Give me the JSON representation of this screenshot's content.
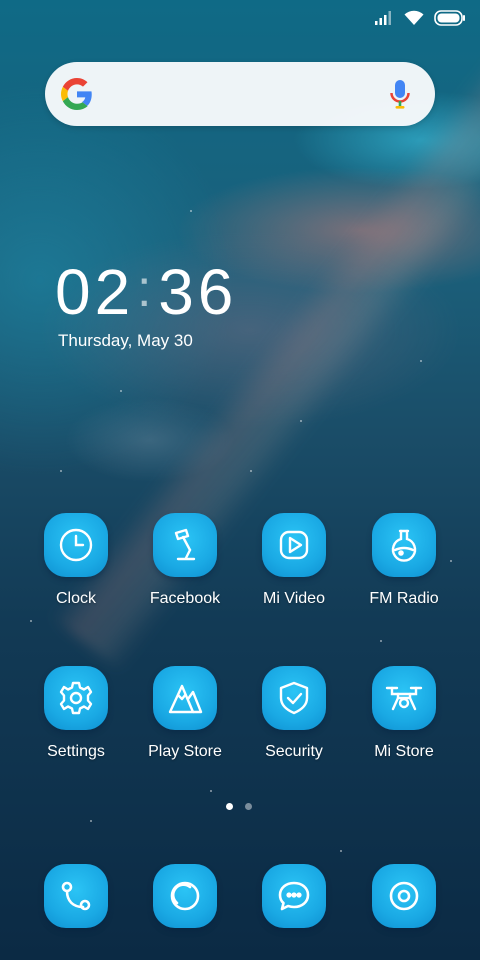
{
  "status_bar": {
    "icons": [
      "signal-icon",
      "wifi-icon",
      "battery-icon"
    ]
  },
  "search_bar": {
    "logo": "google-g-icon",
    "action": "microphone-icon"
  },
  "clock": {
    "hours": "02",
    "separator": ":",
    "minutes": "36",
    "date": "Thursday, May 30"
  },
  "apps": [
    {
      "label": "Clock",
      "icon": "clock-icon"
    },
    {
      "label": "Facebook",
      "icon": "desk-lamp-icon"
    },
    {
      "label": "Mi Video",
      "icon": "play-icon"
    },
    {
      "label": "FM Radio",
      "icon": "flask-icon"
    },
    {
      "label": "Settings",
      "icon": "gear-icon"
    },
    {
      "label": "Play Store",
      "icon": "mountain-icon"
    },
    {
      "label": "Security",
      "icon": "shield-check-icon"
    },
    {
      "label": "Mi Store",
      "icon": "drone-icon"
    }
  ],
  "page_indicator": {
    "pages": 2,
    "active": 1
  },
  "dock": [
    {
      "icon": "phone-icon"
    },
    {
      "icon": "browser-ring-icon"
    },
    {
      "icon": "message-icon"
    },
    {
      "icon": "camera-icon"
    }
  ],
  "colors": {
    "icon_tile": "#1aa9e4",
    "icon_stroke": "#ffffff",
    "search_bg": "#f8fafc"
  }
}
